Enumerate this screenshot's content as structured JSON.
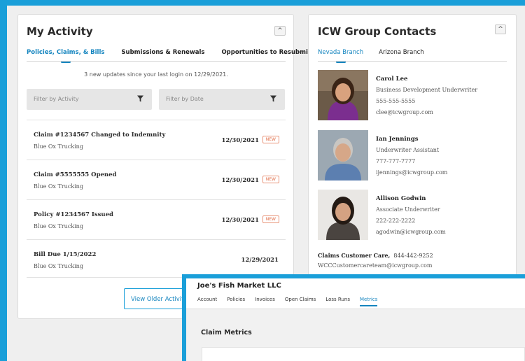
{
  "activity": {
    "title": "My Activity",
    "collapse_glyph": "^",
    "tabs": [
      {
        "label": "Policies, Claims, & Bills",
        "active": true
      },
      {
        "label": "Submissions & Renewals",
        "active": false
      },
      {
        "label": "Opportunities to Resubmit",
        "active": false
      }
    ],
    "updates_text": "3 new updates since your last login on 12/29/2021.",
    "filter_activity": "Filter by Activity",
    "filter_date": "Filter by Date",
    "items": [
      {
        "title": "Claim #1234567 Changed to Indemnity",
        "sub": "Blue Ox Trucking",
        "date": "12/30/2021",
        "badge": "NEW"
      },
      {
        "title": "Claim #5555555 Opened",
        "sub": "Blue Ox Trucking",
        "date": "12/30/2021",
        "badge": "NEW"
      },
      {
        "title": "Policy #1234567 Issued",
        "sub": "Blue Ox Trucking",
        "date": "12/30/2021",
        "badge": "NEW"
      },
      {
        "title": "Bill Due 1/15/2022",
        "sub": "Blue Ox Trucking",
        "date": "12/29/2021",
        "badge": ""
      }
    ],
    "older_button": "View Older Activity"
  },
  "contacts": {
    "title": "ICW Group Contacts",
    "collapse_glyph": "^",
    "tabs": [
      {
        "label": "Nevada Branch",
        "active": true
      },
      {
        "label": "Arizona Branch",
        "active": false
      }
    ],
    "people": [
      {
        "name": "Carol Lee",
        "role": "Business Development Underwriter",
        "phone": "555-555-5555",
        "email": "clee@icwgroup.com"
      },
      {
        "name": "Ian Jennings",
        "role": "Underwriter Assistant",
        "phone": "777-777-7777",
        "email": "ijennings@icwgroup.com"
      },
      {
        "name": "Allison Godwin",
        "role": "Associate Underwriter",
        "phone": "222-222-2222",
        "email": "agodwin@icwgroup.com"
      }
    ],
    "claims_label": "Claims Customer Care,",
    "claims_phone": "844-442-9252",
    "claims_email": "WCCCustomercareteam@icwgroup.com"
  },
  "overlay": {
    "account_name": "Joe's Fish Market LLC",
    "tabs": [
      {
        "label": "Account",
        "active": false
      },
      {
        "label": "Policies",
        "active": false
      },
      {
        "label": "Invoices",
        "active": false
      },
      {
        "label": "Open Claims",
        "active": false
      },
      {
        "label": "Loss Runs",
        "active": false
      },
      {
        "label": "Metrics",
        "active": true
      }
    ],
    "section_title": "Claim Metrics"
  },
  "colors": {
    "accent": "#1a9fd9",
    "link": "#1585bf",
    "new_badge": "#e06a44"
  }
}
